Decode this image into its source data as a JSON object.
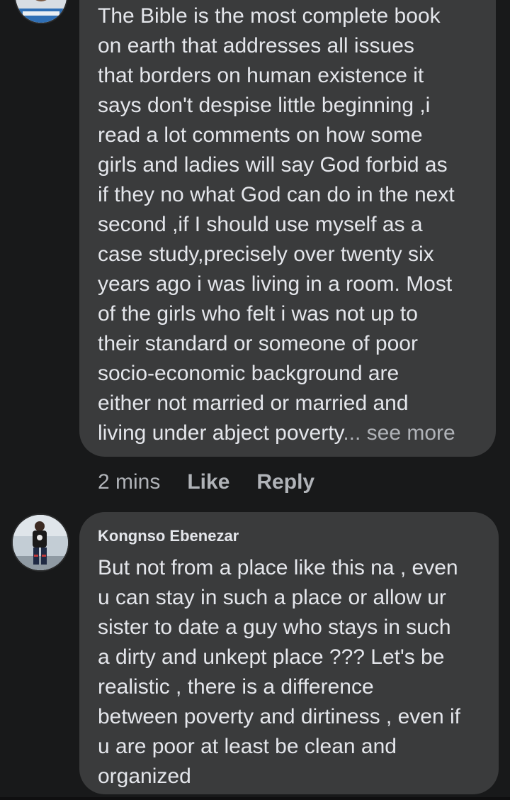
{
  "comments": [
    {
      "author": "",
      "text": "The Bible is the most complete book\non earth that addresses all issues\nthat borders on human existence it\nsays don't despise little beginning  ,i\nread a lot comments on how some\ngirls and ladies will say God forbid as\nif they no what God can do in the next\nsecond ,if I should use myself as a\ncase study,precisely over twenty six\nyears ago i was living in a room. Most\nof the girls who felt i was not up to\ntheir standard or someone of poor\nsocio-economic background are\neither not married or married and\nliving under abject poverty",
      "see_more": "... see more",
      "time": "2 mins",
      "like_label": "Like",
      "reply_label": "Reply"
    },
    {
      "author": "Kongnso Ebenezar",
      "text": "But not from a place like this na , even\nu can stay in such a place or allow ur\nsister to date a guy who stays in such\na dirty and unkept place ??? Let's be\nrealistic , there is a difference\nbetween poverty and dirtiness , even if\nu are poor at least be clean and\norganized"
    }
  ],
  "colors": {
    "background": "#18191a",
    "bubble": "#3a3b3c",
    "primary_text": "#e4e6eb",
    "secondary_text": "#b0b3b8"
  }
}
